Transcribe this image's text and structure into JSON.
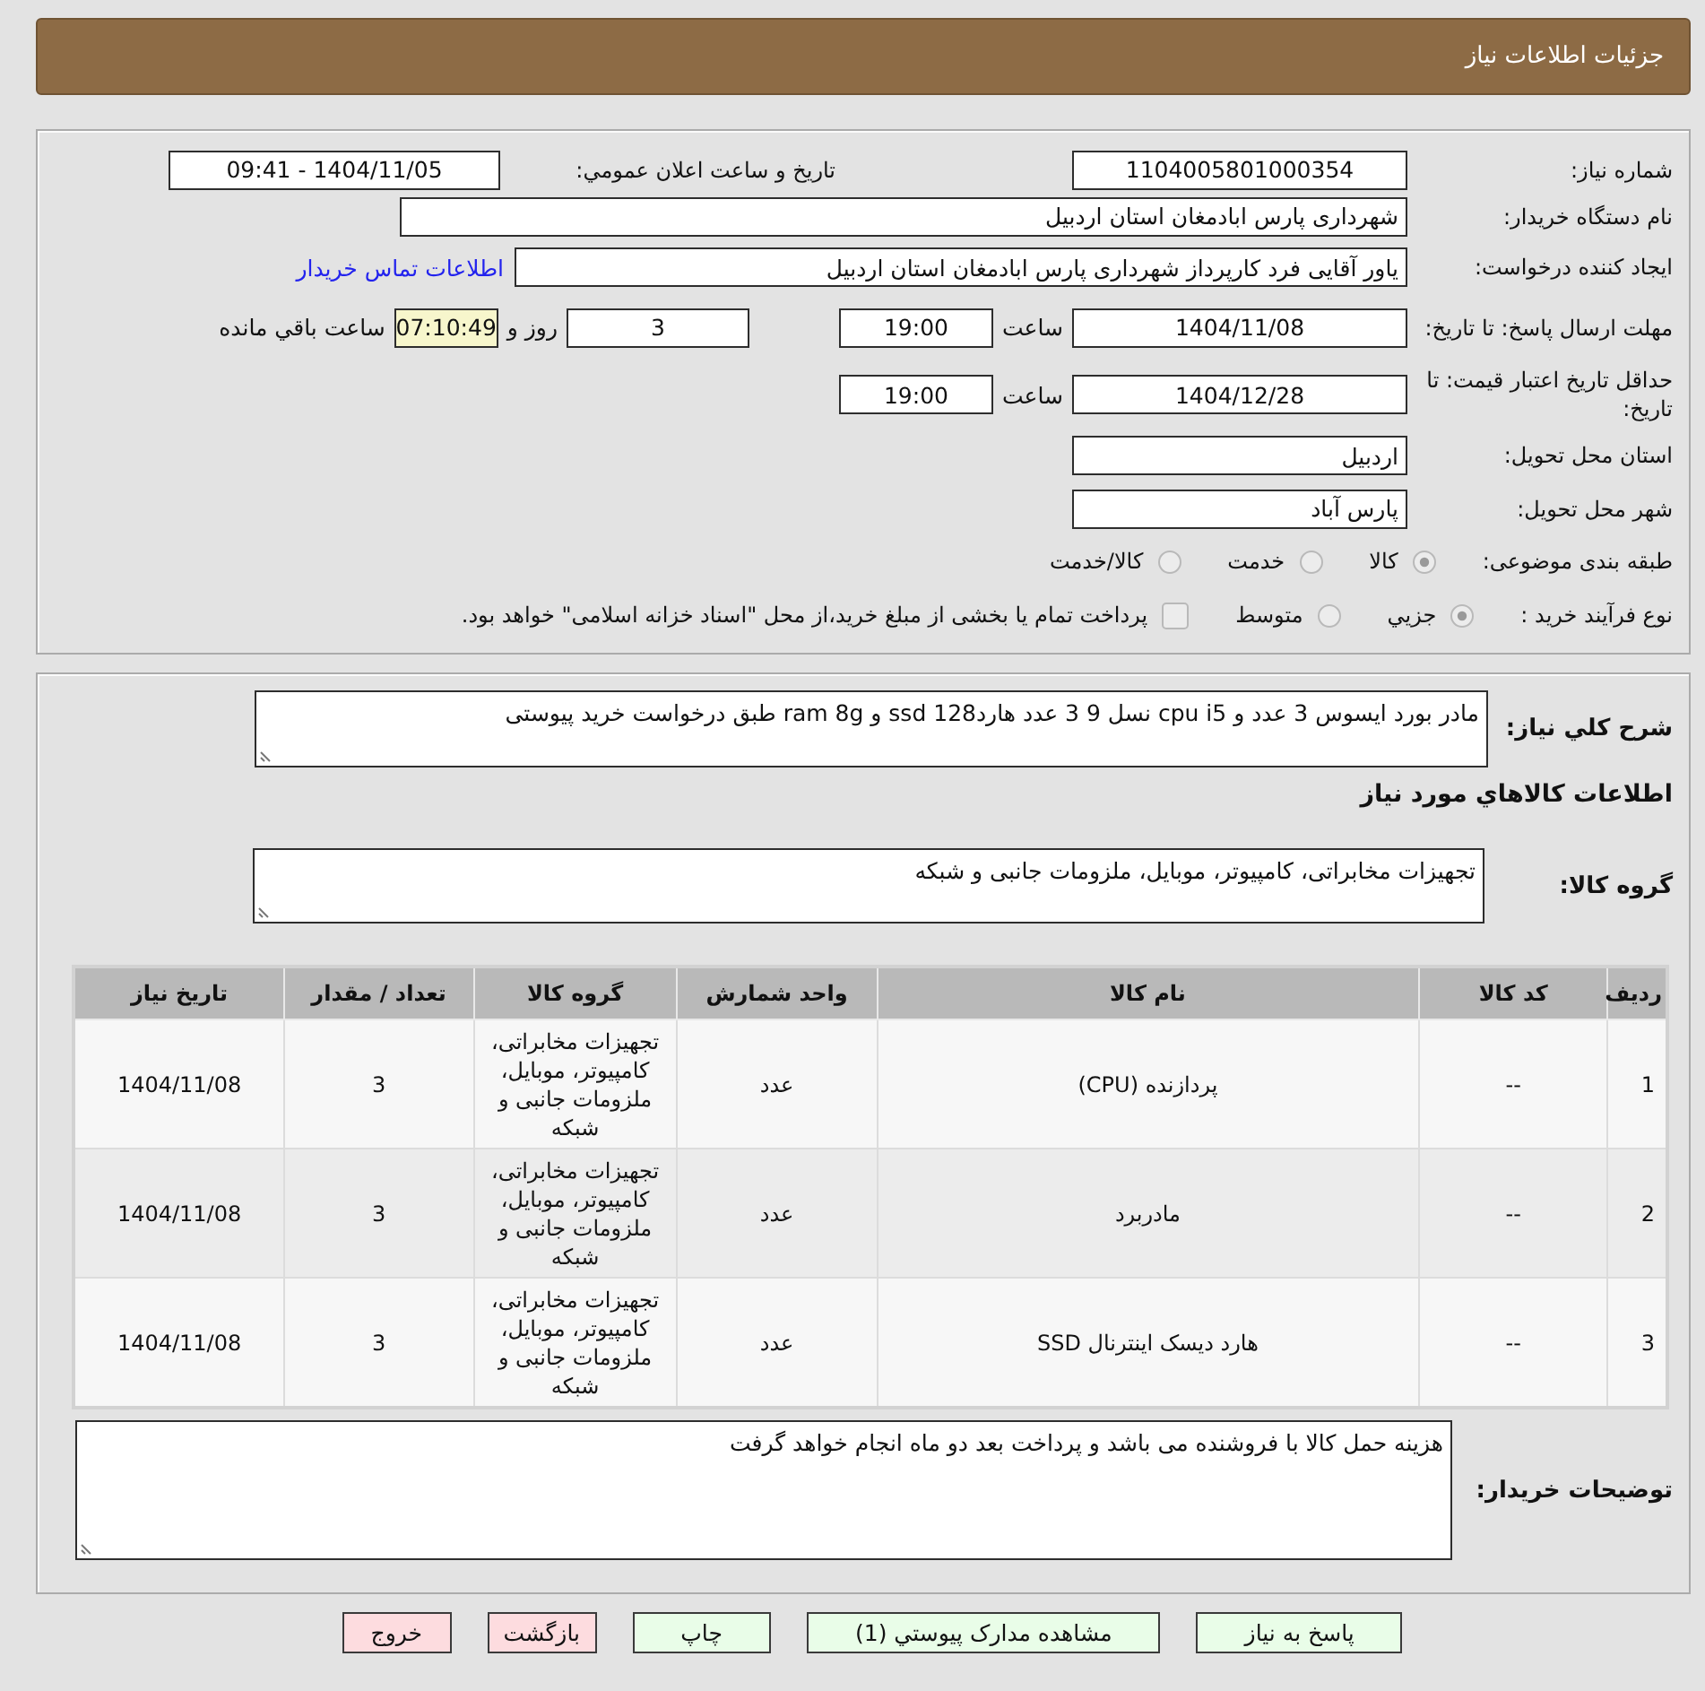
{
  "header": {
    "title": "جزئیات اطلاعات نیاز"
  },
  "details": {
    "need_number": {
      "label": "شماره نیاز:",
      "value": "1104005801000354"
    },
    "announce": {
      "label": "تاریخ و ساعت اعلان عمومي:",
      "value": "1404/11/05 - 09:41"
    },
    "buyer_org": {
      "label": "نام دستگاه خریدار:",
      "value": "شهرداری پارس ابادمغان استان اردبیل"
    },
    "requester": {
      "label": "ایجاد کننده درخواست:",
      "value": "یاور آقایی فرد کارپرداز شهرداری پارس ابادمغان استان اردبیل",
      "link": "اطلاعات تماس خریدار"
    },
    "reply_deadline": {
      "label": "مهلت ارسال پاسخ: تا تاریخ:",
      "date": "1404/11/08",
      "time_label": "ساعت",
      "time": "19:00",
      "days": "3",
      "days_label": "روز و",
      "remaining": "07:10:49",
      "remaining_label": "ساعت باقي مانده"
    },
    "price_validity": {
      "label": "حداقل تاریخ اعتبار قیمت: تا تاریخ:",
      "date": "1404/12/28",
      "time_label": "ساعت",
      "time": "19:00"
    },
    "province": {
      "label": "استان محل تحویل:",
      "value": "اردبیل"
    },
    "city": {
      "label": "شهر محل تحویل:",
      "value": "پارس آباد"
    },
    "category": {
      "label": "طبقه بندی موضوعی:",
      "options": [
        {
          "label": "کالا",
          "selected": true
        },
        {
          "label": "خدمت",
          "selected": false
        },
        {
          "label": "کالا/خدمت",
          "selected": false
        }
      ]
    },
    "process": {
      "label": "نوع فرآیند خرید :",
      "options": [
        {
          "label": "جزيي",
          "selected": true
        },
        {
          "label": "متوسط",
          "selected": false
        }
      ],
      "treasury": {
        "label": "پرداخت تمام یا بخشی از مبلغ خرید،از محل \"اسناد خزانه اسلامی\" خواهد بود.",
        "checked": false
      }
    }
  },
  "summary": {
    "label": "شرح کلي نیاز:",
    "value": "مادر بورد ایسوس 3 عدد و cpu i5 نسل 9 3 عدد هارد128 ssd  و ram 8g طبق درخواست خرید پیوستی"
  },
  "goods_heading": "اطلاعات کالاهاي مورد نیاز",
  "goods_group": {
    "label": "گروه کالا:",
    "value": "تجهیزات مخابراتی، کامپیوتر، موبایل، ملزومات جانبی و شبکه"
  },
  "table": {
    "columns": [
      "ردیف",
      "کد کالا",
      "نام کالا",
      "واحد شمارش",
      "گروه کالا",
      "تعداد / مقدار",
      "تاریخ نیاز"
    ],
    "rows": [
      [
        "1",
        "--",
        "پردازنده (CPU)",
        "عدد",
        "تجهیزات مخابراتی، کامپیوتر، موبایل، ملزومات جانبی و شبکه",
        "3",
        "1404/11/08"
      ],
      [
        "2",
        "--",
        "مادربرد",
        "عدد",
        "تجهیزات مخابراتی، کامپیوتر، موبایل، ملزومات جانبی و شبکه",
        "3",
        "1404/11/08"
      ],
      [
        "3",
        "--",
        "هارد دیسک اینترنال SSD",
        "عدد",
        "تجهیزات مخابراتی، کامپیوتر، موبایل، ملزومات جانبی و شبکه",
        "3",
        "1404/11/08"
      ]
    ]
  },
  "buyer_notes": {
    "label": "توضیحات خریدار:",
    "value": "هزینه حمل کالا با فروشنده می باشد و پرداخت بعد دو ماه انجام خواهد گرفت"
  },
  "buttons": [
    {
      "label": "پاسخ به نیاز",
      "kind": "normal"
    },
    {
      "label": "مشاهده مدارک پیوستي (1)",
      "kind": "normal"
    },
    {
      "label": "چاپ",
      "kind": "normal"
    },
    {
      "label": "بازگشت",
      "kind": "cancel"
    },
    {
      "label": "خروج",
      "kind": "cancel"
    }
  ]
}
